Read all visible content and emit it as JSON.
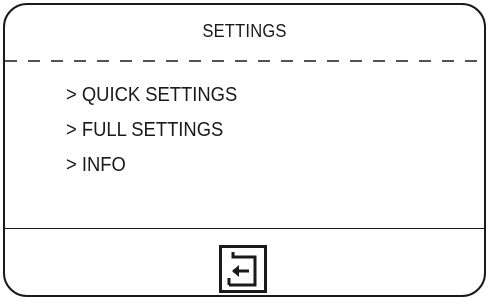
{
  "screen": {
    "title": "SETTINGS"
  },
  "menu": {
    "items": [
      {
        "label": "> QUICK SETTINGS"
      },
      {
        "label": "> FULL SETTINGS"
      },
      {
        "label": "> INFO"
      }
    ]
  },
  "footer": {
    "back_icon": "back-arrow-icon"
  },
  "colors": {
    "foreground": "#1a1a1a",
    "background": "#ffffff"
  }
}
